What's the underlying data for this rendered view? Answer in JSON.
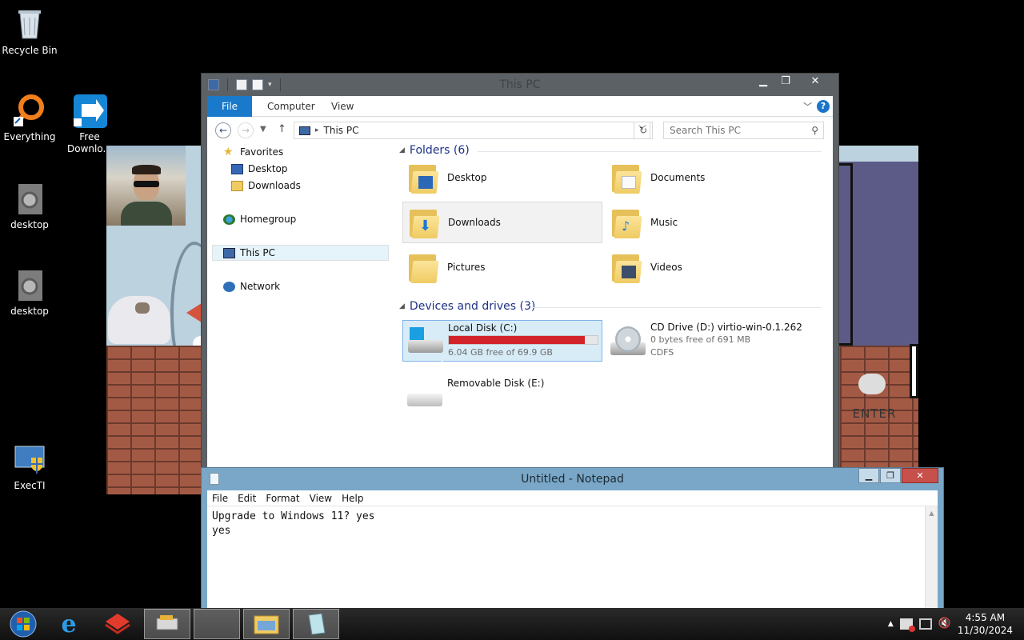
{
  "desktop": {
    "icons": [
      {
        "label": "Recycle Bin"
      },
      {
        "label": "Everything"
      },
      {
        "label": "Free Downlo..."
      },
      {
        "label": "desktop"
      },
      {
        "label": "desktop"
      },
      {
        "label": "ExecTI"
      }
    ]
  },
  "background_app": {
    "enter_label": "ENTER"
  },
  "explorer": {
    "title": "This PC",
    "ribbon": {
      "tabs": [
        "File",
        "Computer",
        "View"
      ]
    },
    "address": {
      "path_item": "This PC"
    },
    "search": {
      "placeholder": "Search This PC"
    },
    "nav": {
      "favorites": "Favorites",
      "desktop": "Desktop",
      "downloads": "Downloads",
      "homegroup": "Homegroup",
      "this_pc": "This PC",
      "network": "Network"
    },
    "folders_header": "Folders (6)",
    "folders": [
      "Desktop",
      "Documents",
      "Downloads",
      "Music",
      "Pictures",
      "Videos"
    ],
    "devices_header": "Devices and drives (3)",
    "drives": [
      {
        "name": "Local Disk (C:)",
        "free": "6.04 GB free of 69.9 GB",
        "used_fraction": 0.914
      },
      {
        "name": "CD Drive (D:) virtio-win-0.1.262",
        "free": "0 bytes free of 691 MB",
        "fs": "CDFS"
      },
      {
        "name": "Removable Disk (E:)"
      }
    ]
  },
  "notepad": {
    "title": "Untitled - Notepad",
    "menu": [
      "File",
      "Edit",
      "Format",
      "View",
      "Help"
    ],
    "content": "Upgrade to Windows 11? yes\nyes"
  },
  "taskbar": {
    "time": "4:55 AM",
    "date": "11/30/2024"
  },
  "colors": {
    "accent": "#1979ca",
    "drive_bar": "#d2232a",
    "folder_header": "#1e3287"
  }
}
